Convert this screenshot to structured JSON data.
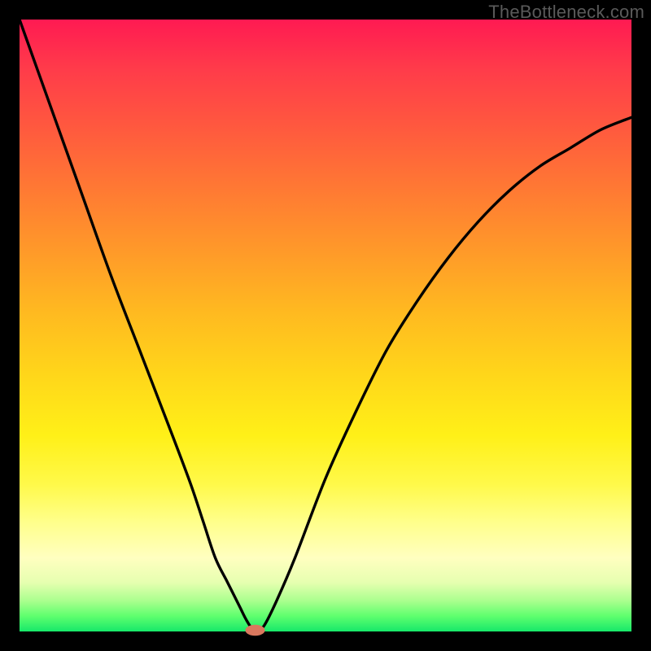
{
  "watermark": "TheBottleneck.com",
  "colors": {
    "frame": "#000000",
    "curve": "#000000",
    "marker": "#d9785e"
  },
  "chart_data": {
    "type": "line",
    "title": "",
    "xlabel": "",
    "ylabel": "",
    "xlim": [
      0,
      100
    ],
    "ylim": [
      0,
      100
    ],
    "grid": false,
    "legend": false,
    "series": [
      {
        "name": "bottleneck-curve",
        "x": [
          0,
          5,
          10,
          15,
          20,
          25,
          28,
          30,
          32,
          34,
          36,
          37,
          38,
          39,
          40,
          42,
          45,
          50,
          55,
          60,
          65,
          70,
          75,
          80,
          85,
          90,
          95,
          100
        ],
        "y": [
          100,
          86,
          72,
          58,
          45,
          32,
          24,
          18,
          12,
          8,
          4,
          2,
          0.5,
          0.3,
          1,
          5,
          12,
          25,
          36,
          46,
          54,
          61,
          67,
          72,
          76,
          79,
          82,
          84
        ]
      }
    ],
    "marker": {
      "x": 38.5,
      "y": 0.2,
      "rx": 1.6,
      "ry": 0.9
    },
    "background_gradient": [
      {
        "stop": 0.0,
        "color": "#ff1a52"
      },
      {
        "stop": 0.5,
        "color": "#ffba20"
      },
      {
        "stop": 0.8,
        "color": "#ffff8a"
      },
      {
        "stop": 1.0,
        "color": "#17e86a"
      }
    ]
  }
}
